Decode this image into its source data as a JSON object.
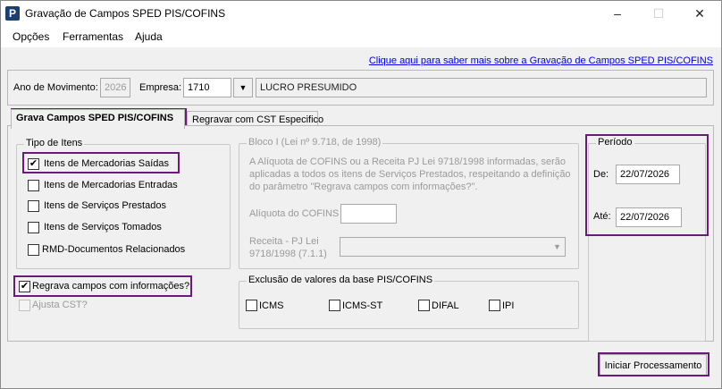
{
  "window": {
    "title": "Gravação de Campos SPED PIS/COFINS",
    "icon_letter": "P",
    "minimize": "–",
    "maximize": "☐",
    "close": "✕"
  },
  "menu": {
    "items": [
      "Opções",
      "Ferramentas",
      "Ajuda"
    ]
  },
  "help_link": "Clique aqui para saber mais sobre a Gravação de Campos SPED PIS/COFINS",
  "header": {
    "ano_label": "Ano de Movimento:",
    "ano_value": "2026",
    "empresa_label": "Empresa:",
    "empresa_value": "1710",
    "empresa_name": "LUCRO PRESUMIDO"
  },
  "tabs": [
    {
      "label": "Grava Campos SPED PIS/COFINS",
      "active": true
    },
    {
      "label": "Regravar com CST Especifico",
      "active": false
    }
  ],
  "tipo_itens": {
    "title": "Tipo de Itens",
    "items": [
      {
        "label": "Itens de Mercadorias Saídas",
        "checked": true
      },
      {
        "label": "Itens de Mercadorias Entradas",
        "checked": false
      },
      {
        "label": "Itens de Serviços Prestados",
        "checked": false
      },
      {
        "label": "Itens de Serviços Tomados",
        "checked": false
      },
      {
        "label": "RMD-Documentos Relacionados",
        "checked": false
      }
    ]
  },
  "regrava": {
    "label": "Regrava campos com informações?",
    "checked": true
  },
  "ajusta_cst": {
    "label": "Ajusta CST?",
    "checked": false,
    "enabled": false
  },
  "bloco_i": {
    "title": "Bloco I (Lei nº 9.718, de 1998)",
    "description": "A Alíquota de COFINS ou a Receita PJ Lei 9718/1998 informadas, serão aplicadas a todos os itens de Serviços Prestados, respeitando a definição do parâmetro \"Regrava campos com informações?\".",
    "aliquota_label": "Alíquota do COFINS",
    "aliquota_value": "",
    "receita_label_1": "Receita - PJ Lei",
    "receita_label_2": "9718/1998 (7.1.1)",
    "receita_value": ""
  },
  "exclusao": {
    "title": "Exclusão de valores da base PIS/COFINS",
    "items": [
      {
        "label": "ICMS",
        "checked": false
      },
      {
        "label": "ICMS-ST",
        "checked": false
      },
      {
        "label": "DIFAL",
        "checked": false
      },
      {
        "label": "IPI",
        "checked": false
      }
    ]
  },
  "periodo": {
    "title": "Período",
    "de_label": "De:",
    "de_value": "22/07/2026",
    "ate_label": "Até:",
    "ate_value": "22/07/2026"
  },
  "start_button": "Iniciar Processamento",
  "colors": {
    "highlight": "#6a1b7a",
    "link": "#0000ee"
  }
}
